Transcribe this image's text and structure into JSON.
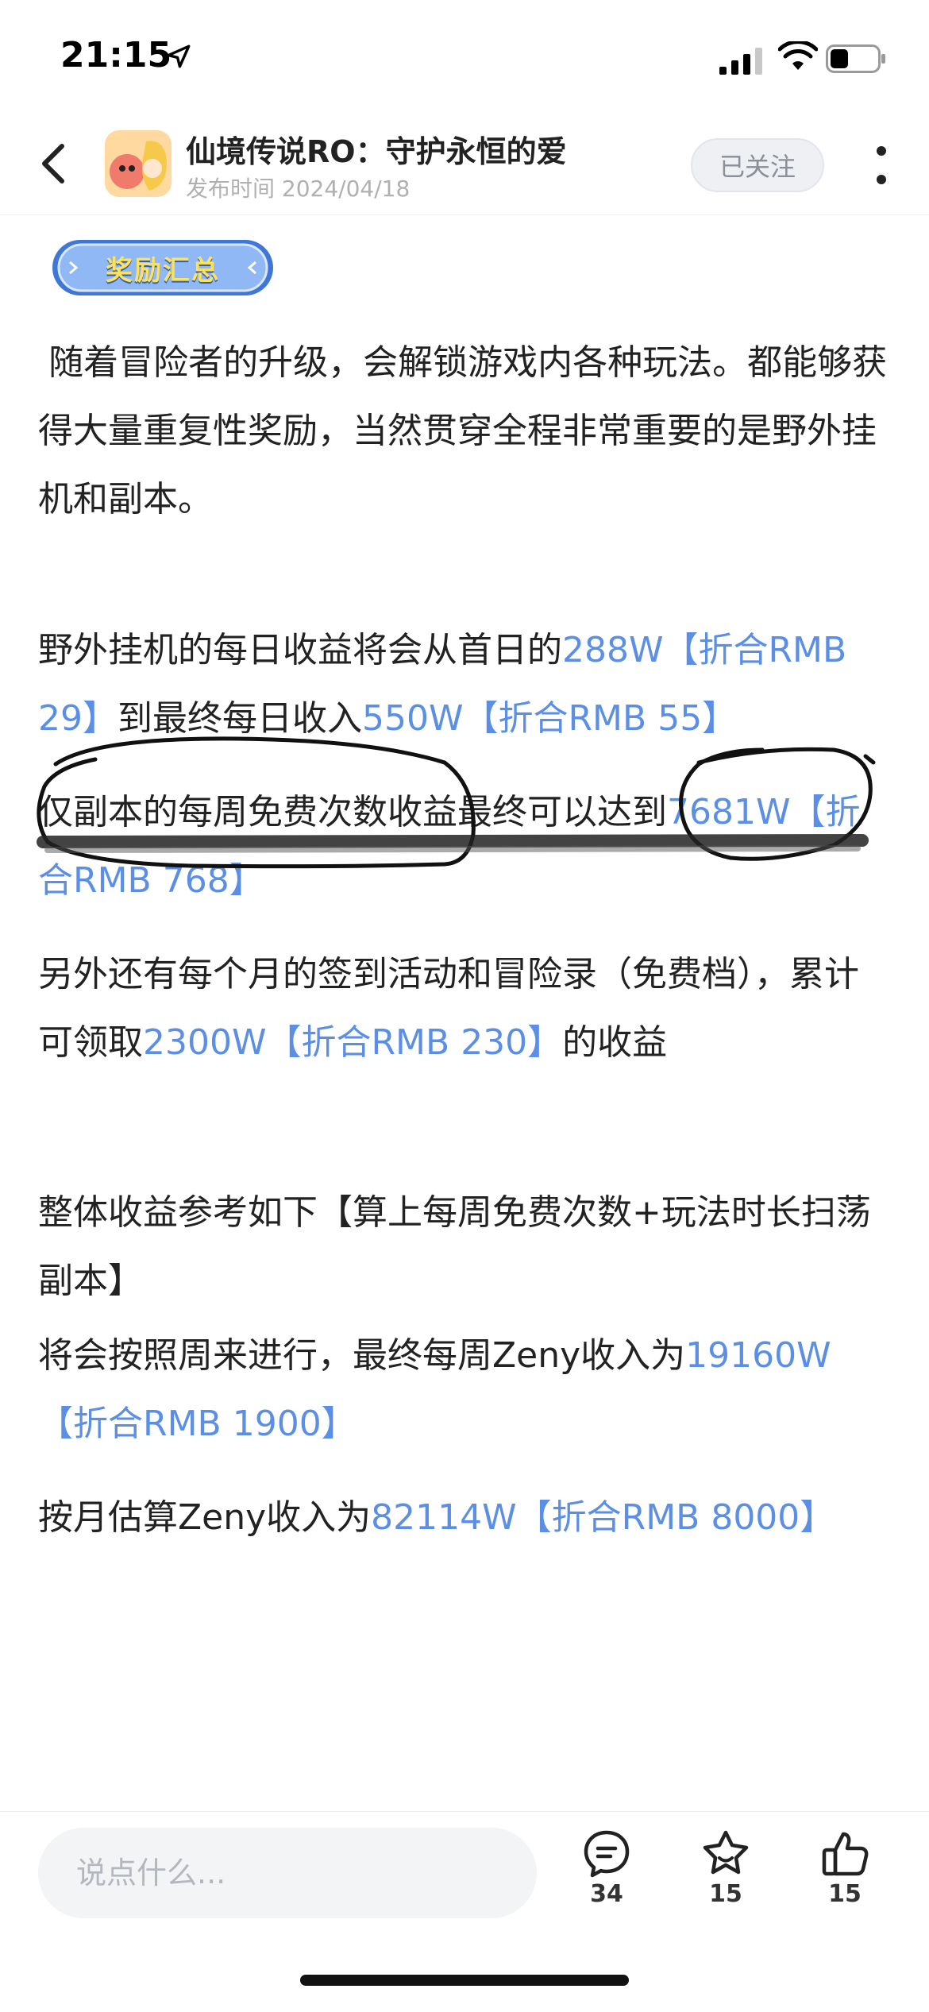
{
  "status_bar": {
    "time": "21:15"
  },
  "header": {
    "title": "仙境传说RO：守护永恒的爱",
    "publish_label": "发布时间",
    "publish_date": "2024/04/18",
    "follow_label": "已关注"
  },
  "banner": {
    "label": "奖励汇总"
  },
  "content": {
    "p1": "随着冒险者的升级，会解锁游戏内各种玩法。都能够获得大量重复性奖励，当然贯穿全程非常重要的是野外挂机和副本。",
    "p2_a": "野外挂机的每日收益将会从首日的",
    "p2_b": "288W【折合RMB 29】",
    "p2_c": "到最终每日收入",
    "p2_d": "550W【折合RMB 55】",
    "p3_a": "仅副本的每周免费次数收益最终可以达到",
    "p3_b": "7681W【折合RMB 768】",
    "p4_a": "另外还有每个月的签到活动和冒险录（免费档），累计可领取",
    "p4_b": "2300W【折合RMB 230】",
    "p4_c": "的收益",
    "p5": "整体收益参考如下【算上每周免费次数+玩法时长扫荡副本】",
    "p6_a": "将会按照周来进行，最终每周Zeny收入为",
    "p6_b": "19160W【折合RMB 1900】",
    "p7_a": "按月估算Zeny收入为",
    "p7_b": "82114W【折合RMB 8000】"
  },
  "bottom_bar": {
    "comment_placeholder": "说点什么...",
    "comment_count": "34",
    "favorite_count": "15",
    "like_count": "15"
  },
  "colors": {
    "link": "#5b8fe6",
    "text": "#222222",
    "muted": "#b0b0b0"
  },
  "icons": [
    "location-arrow-icon",
    "cellular-signal-icon",
    "wifi-icon",
    "battery-icon",
    "back-icon",
    "more-icon",
    "comment-icon",
    "favorite-icon",
    "like-icon"
  ]
}
